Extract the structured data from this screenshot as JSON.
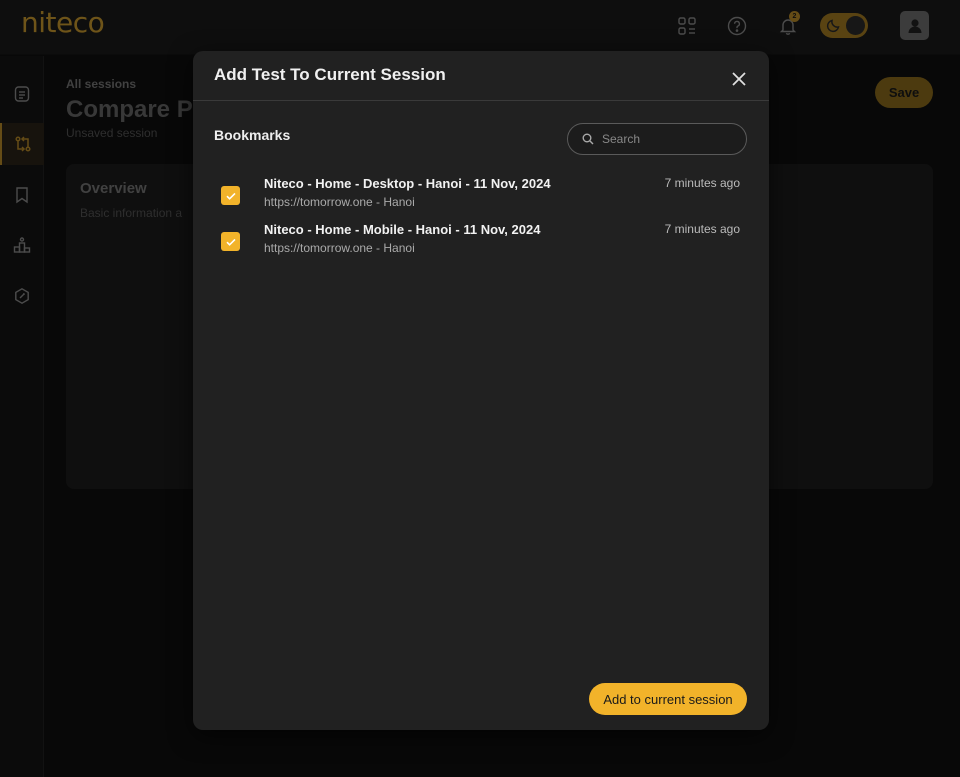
{
  "app": {
    "logo": "niteco"
  },
  "topbar": {
    "notification_count": "2",
    "icons": [
      "apps-icon",
      "help-icon",
      "bell-icon",
      "theme-toggle",
      "avatar-icon"
    ]
  },
  "sidebar": {
    "items": [
      {
        "icon": "document-icon",
        "active": false
      },
      {
        "icon": "compare-icon",
        "active": true
      },
      {
        "icon": "bookmark-icon",
        "active": false
      },
      {
        "icon": "chart-icon",
        "active": false
      },
      {
        "icon": "settings-icon",
        "active": false
      }
    ]
  },
  "page": {
    "breadcrumb": "All sessions",
    "title": "Compare P",
    "subtitle": "Unsaved session",
    "save_label": "Save",
    "overview_title": "Overview",
    "overview_sub": "Basic information a"
  },
  "modal": {
    "title": "Add Test To Current Session",
    "section_label": "Bookmarks",
    "search_placeholder": "Search",
    "items": [
      {
        "title": "Niteco - Home - Desktop - Hanoi - 11 Nov, 2024",
        "subtitle": "https://tomorrow.one - Hanoi",
        "time": "7 minutes ago",
        "checked": true
      },
      {
        "title": "Niteco - Home - Mobile - Hanoi - 11 Nov, 2024",
        "subtitle": "https://tomorrow.one - Hanoi",
        "time": "7 minutes ago",
        "checked": true
      }
    ],
    "add_button": "Add to current session"
  },
  "colors": {
    "accent": "#f2b32a",
    "background": "#0f0f0f",
    "modal": "#212121"
  }
}
